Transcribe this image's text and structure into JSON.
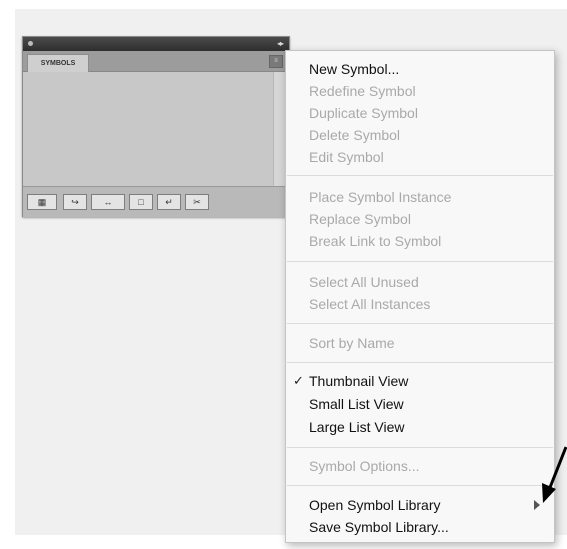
{
  "panel": {
    "tab_label": "SYMBOLS",
    "menu_button_label": "≡",
    "footer_buttons": [
      {
        "name": "symbol-libraries-menu-button",
        "label": "▦"
      },
      {
        "name": "place-symbol-instance-button",
        "label": "↪"
      },
      {
        "name": "break-link-button",
        "label": "↔"
      },
      {
        "name": "symbol-options-button",
        "label": "□"
      },
      {
        "name": "new-symbol-button",
        "label": "↵"
      },
      {
        "name": "delete-symbol-button",
        "label": "✂"
      }
    ]
  },
  "menu": {
    "new_symbol": "New Symbol...",
    "redefine_symbol": "Redefine Symbol",
    "duplicate_symbol": "Duplicate Symbol",
    "delete_symbol": "Delete Symbol",
    "edit_symbol": "Edit Symbol",
    "place_symbol_instance": "Place Symbol Instance",
    "replace_symbol": "Replace Symbol",
    "break_link": "Break Link to Symbol",
    "select_all_unused": "Select All Unused",
    "select_all_instances": "Select All Instances",
    "sort_by_name": "Sort by Name",
    "thumbnail_view": "Thumbnail View",
    "small_list_view": "Small List View",
    "large_list_view": "Large List View",
    "symbol_options": "Symbol Options...",
    "open_symbol_library": "Open Symbol Library",
    "save_symbol_library": "Save Symbol Library...",
    "check_mark": "✓"
  },
  "colors": {
    "enabled_text": "#111111",
    "disabled_text": "#a9a9a9",
    "panel_bg": "#c9c9c9",
    "titlebar": "#3a3a3a"
  }
}
